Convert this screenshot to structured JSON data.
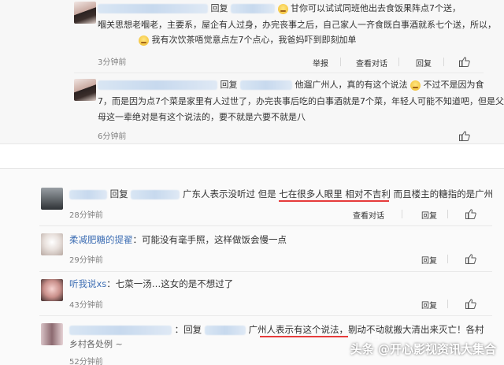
{
  "comments": [
    {
      "line1_suffix": "甘你可以试试同班他出去食饭果阵点7个送，",
      "line2": "嗰关思想老嗰老，主要系，屋企有人过身，办完丧事之后，自己家人一齐食既白事酒就系七个送，所以，",
      "line3": "我有次饮茶唔觉意点左7个点心，我爸妈吓到即刻加单",
      "reply_prefix": "回复",
      "time": "3分钟前",
      "actions": [
        "举报",
        "查看对话",
        "回复"
      ]
    },
    {
      "reply_prefix": "回复",
      "line1_mid": "他遛广州人，真的有这个说法",
      "line1_end": "不过不是因为食",
      "line2": "7，而是因为点7个菜是家里有人过世了，办完丧事后吃的白事酒就是7个菜，年轻人可能不知道吧，但是父",
      "line3": "母这一辈绝对是有这个说法的，要不就是六要不就是八",
      "time": "6分钟前"
    },
    {
      "reply_prefix": "回复",
      "text_a": "广东人表示没听过 但是",
      "text_b": "七在很多人眼里 相对不吉利",
      "text_c": " 而且楼主的糖指的是广州",
      "time": "28分钟前",
      "actions": [
        "查看对话",
        "回复"
      ]
    },
    {
      "username": "柔减肥糖的提翟",
      "text": "：可能没有毫手照，这样做饭会慢一点",
      "time": "29分钟前",
      "actions": [
        "回复"
      ]
    },
    {
      "username": "听我说xs",
      "text": "：七菜一汤…这女的是不想过了",
      "time": "43分钟前",
      "actions": [
        "回复"
      ]
    },
    {
      "reply_prefix": "：回复",
      "text_a": "广州人表示有这个说法",
      "text_b": "，剔动不动就搬大清出来灭亡！各村",
      "line2": "乡村各处例 ~",
      "time": "52分钟前"
    }
  ],
  "watermark": "头条 @开心影视资讯大集合"
}
